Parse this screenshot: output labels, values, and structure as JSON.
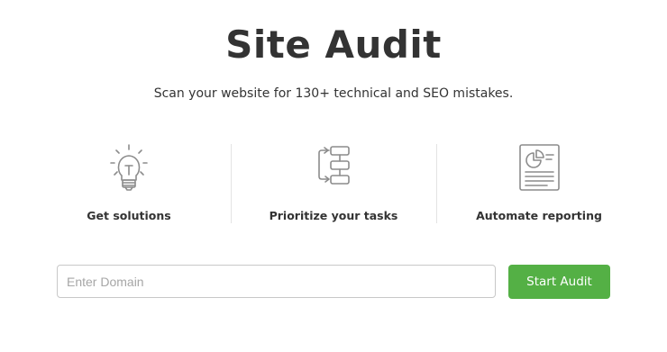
{
  "header": {
    "title": "Site Audit",
    "subtitle": "Scan your website for 130+ technical and SEO mistakes."
  },
  "features": [
    {
      "label": "Get solutions",
      "icon": "lightbulb-icon"
    },
    {
      "label": "Prioritize your tasks",
      "icon": "task-hierarchy-icon"
    },
    {
      "label": "Automate reporting",
      "icon": "report-document-icon"
    }
  ],
  "form": {
    "domain_placeholder": "Enter Domain",
    "domain_value": "",
    "submit_label": "Start Audit"
  },
  "colors": {
    "accent": "#54b045",
    "icon_stroke": "#8c8c8c",
    "text": "#333333"
  }
}
